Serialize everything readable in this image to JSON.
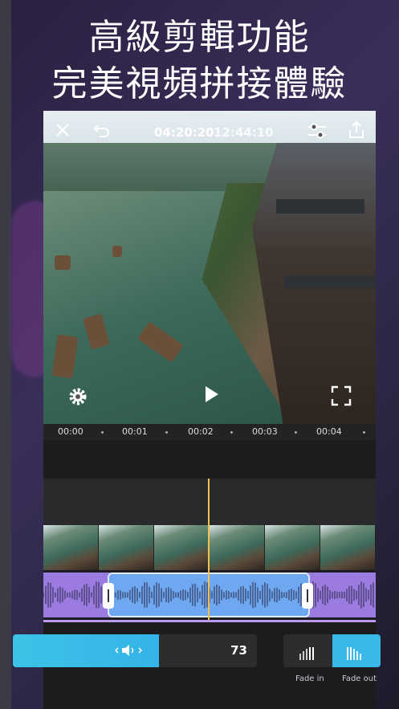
{
  "promo": {
    "line1": "高級剪輯功能",
    "line2": "完美視頻拼接體驗"
  },
  "toolbar": {
    "time_current": "04:20:20",
    "time_total": "12:44:10"
  },
  "ruler": {
    "ticks": [
      "00:00",
      "00:01",
      "00:02",
      "00:03",
      "00:04"
    ]
  },
  "volume": {
    "value": "73",
    "level_fraction": 0.6
  },
  "fade": {
    "fade_in_label": "Fade in",
    "fade_out_label": "Fade out",
    "selected": "fade-out"
  },
  "colors": {
    "accent": "#3ab8e8",
    "audio_track": "#9b7be0",
    "audio_selected": "#6ea8f0",
    "playhead": "#f2c14e"
  }
}
